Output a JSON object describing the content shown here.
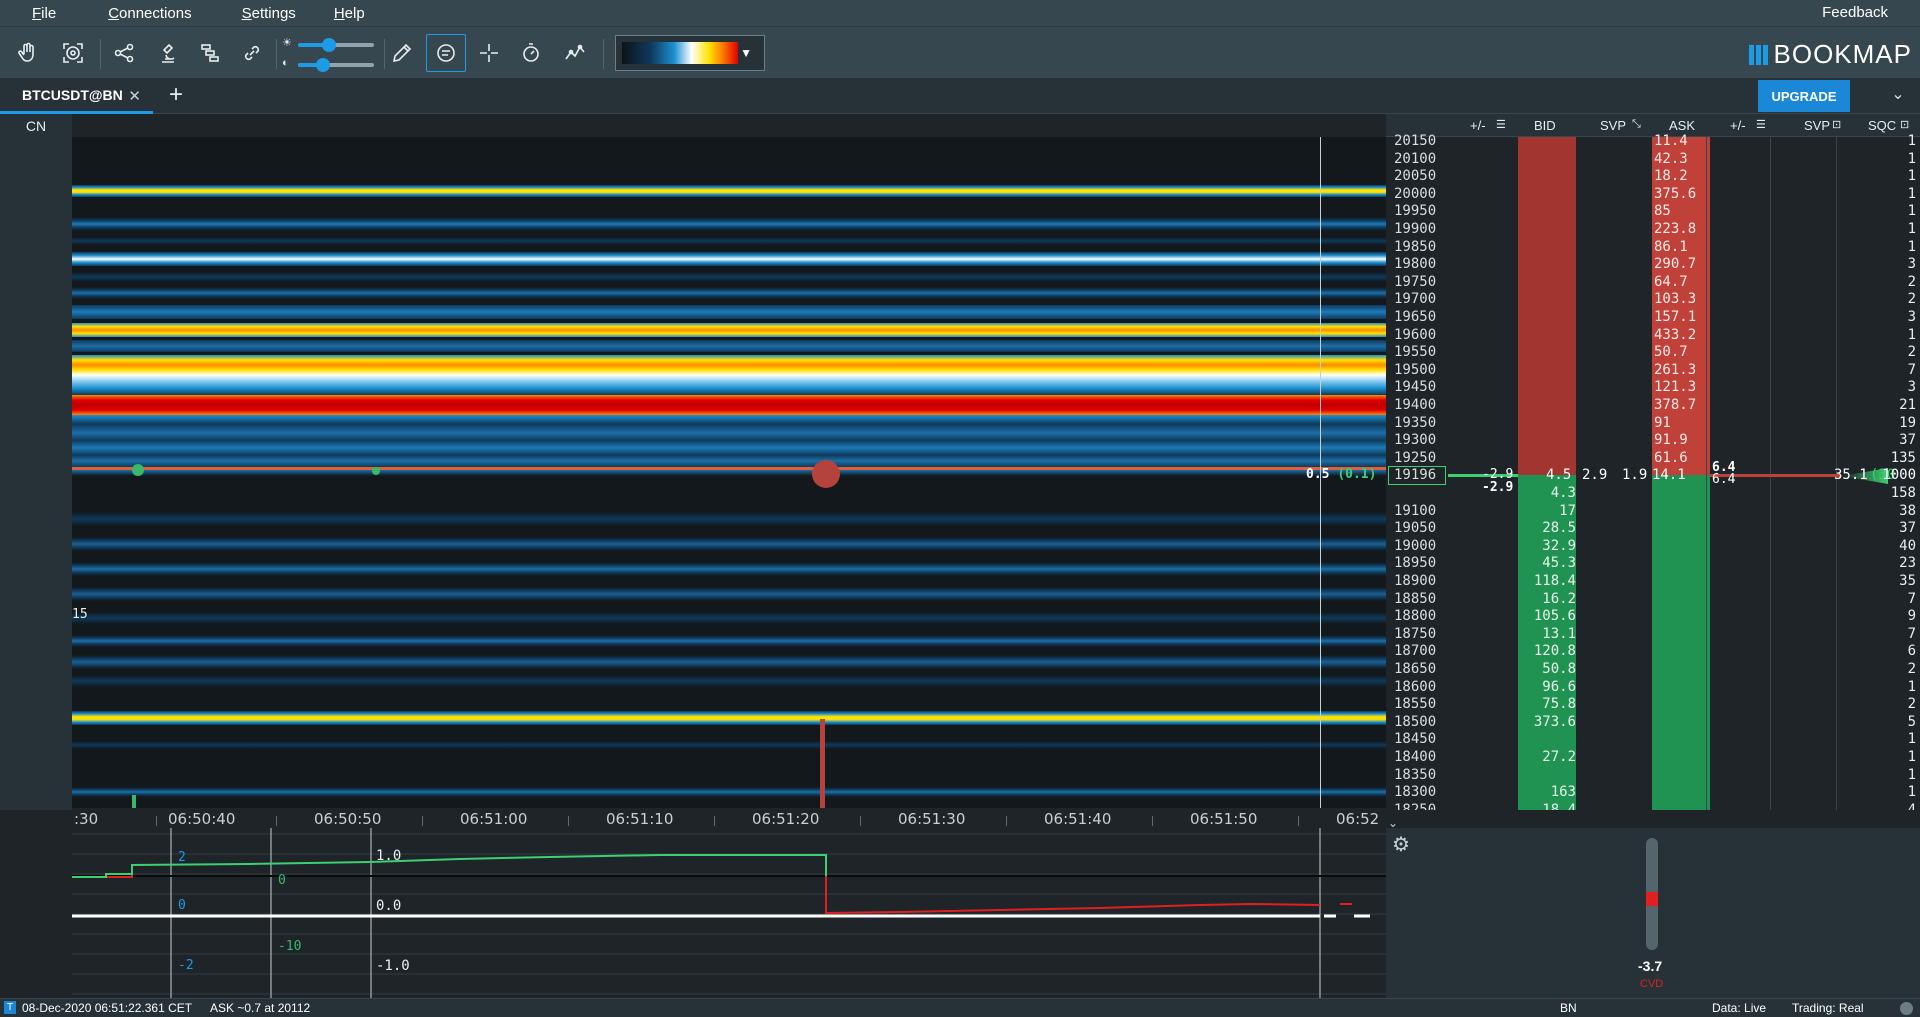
{
  "menu": {
    "file": "File",
    "connections": "Connections",
    "settings": "Settings",
    "help": "Help",
    "feedback": "Feedback"
  },
  "brand": {
    "name": "BOOKMAP",
    "accent": "#1e9be6"
  },
  "tabs": [
    {
      "label": "BTCUSDT@BN"
    }
  ],
  "upgrade_label": "UPGRADE",
  "left_label": "CN",
  "ladder": {
    "headers": {
      "bid_delta": "+/-",
      "bid": "BID",
      "svp_bid": "SVP",
      "ask": "ASK",
      "ask_delta": "+/-",
      "svp": "SVP",
      "sqc": "SQC"
    },
    "rows": [
      {
        "price": "20150",
        "ask": "11.4",
        "sqc": "1"
      },
      {
        "price": "20100",
        "ask": "42.3",
        "sqc": "1"
      },
      {
        "price": "20050",
        "ask": "18.2",
        "sqc": "1"
      },
      {
        "price": "20000",
        "ask": "375.6",
        "sqc": "1"
      },
      {
        "price": "19950",
        "ask": "85",
        "sqc": "1"
      },
      {
        "price": "19900",
        "ask": "223.8",
        "sqc": "1"
      },
      {
        "price": "19850",
        "ask": "86.1",
        "sqc": "1"
      },
      {
        "price": "19800",
        "ask": "290.7",
        "sqc": "3"
      },
      {
        "price": "19750",
        "ask": "64.7",
        "sqc": "2"
      },
      {
        "price": "19700",
        "ask": "103.3",
        "sqc": "2"
      },
      {
        "price": "19650",
        "ask": "157.1",
        "sqc": "3"
      },
      {
        "price": "19600",
        "ask": "433.2",
        "sqc": "1"
      },
      {
        "price": "19550",
        "ask": "50.7",
        "sqc": "2"
      },
      {
        "price": "19500",
        "ask": "261.3",
        "sqc": "7"
      },
      {
        "price": "19450",
        "ask": "121.3",
        "sqc": "3"
      },
      {
        "price": "19400",
        "ask": "378.7",
        "sqc": "21"
      },
      {
        "price": "19350",
        "ask": "91",
        "sqc": "19"
      },
      {
        "price": "19300",
        "ask": "91.9",
        "sqc": "37"
      },
      {
        "price": "19250",
        "ask": "61.6",
        "sqc": "135"
      }
    ],
    "current": {
      "price": "19196",
      "bid_delta": "-2.9",
      "bid_delta2": "-2.9",
      "bid": "4.5",
      "svp_bid": "2.9",
      "svp_bid2": "1.9",
      "ask": "14.1",
      "ask_delta": "6.4",
      "ask_delta2": "6.4",
      "svp": "35.1",
      "svp_pct": "(30",
      "sqc": "1000",
      "heatmap_label": "0.5",
      "heatmap_label2": "(0.1)"
    },
    "bid_rows": [
      {
        "price": "",
        "bid": "4.3",
        "sqc": "158"
      },
      {
        "price": "19100",
        "bid": "17",
        "sqc": "38"
      },
      {
        "price": "19050",
        "bid": "28.5",
        "sqc": "37"
      },
      {
        "price": "19000",
        "bid": "32.9",
        "sqc": "40"
      },
      {
        "price": "18950",
        "bid": "45.3",
        "sqc": "23"
      },
      {
        "price": "18900",
        "bid": "118.4",
        "sqc": "35"
      },
      {
        "price": "18850",
        "bid": "16.2",
        "sqc": "7"
      },
      {
        "price": "18800",
        "bid": "105.6",
        "sqc": "9"
      },
      {
        "price": "18750",
        "bid": "13.1",
        "sqc": "7"
      },
      {
        "price": "18700",
        "bid": "120.8",
        "sqc": "6"
      },
      {
        "price": "18650",
        "bid": "50.8",
        "sqc": "2"
      },
      {
        "price": "18600",
        "bid": "96.6",
        "sqc": "1"
      },
      {
        "price": "18550",
        "bid": "75.8",
        "sqc": "2"
      },
      {
        "price": "18500",
        "bid": "373.6",
        "sqc": "5"
      },
      {
        "price": "18450",
        "bid": "",
        "sqc": "1"
      },
      {
        "price": "18400",
        "bid": "27.2",
        "sqc": "1"
      },
      {
        "price": "18350",
        "bid": "",
        "sqc": "1"
      },
      {
        "price": "18300",
        "bid": "163",
        "sqc": "1"
      },
      {
        "price": "18250",
        "bid": "18.4",
        "sqc": "4"
      }
    ]
  },
  "heatmap_scale_label": "15",
  "time_axis": [
    ":30",
    "06:50:40",
    "06:50:50",
    "06:51:00",
    "06:51:10",
    "06:51:20",
    "06:51:30",
    "06:51:40",
    "06:51:50",
    "06:52"
  ],
  "oscillator": {
    "left_labels": [
      "2",
      "0",
      "-2"
    ],
    "mid_labels": [
      "0",
      "-10"
    ],
    "right_labels": [
      "1.0",
      "0.0",
      "-1.0"
    ]
  },
  "cvd": {
    "value": "-3.7",
    "label": "CVD"
  },
  "status": {
    "datetime": "08-Dec-2020 06:51:22.361 CET",
    "info": "ASK ~0.7 at 20112",
    "exchange": "BN",
    "data": "Data: Live",
    "trading": "Trading: Real"
  }
}
